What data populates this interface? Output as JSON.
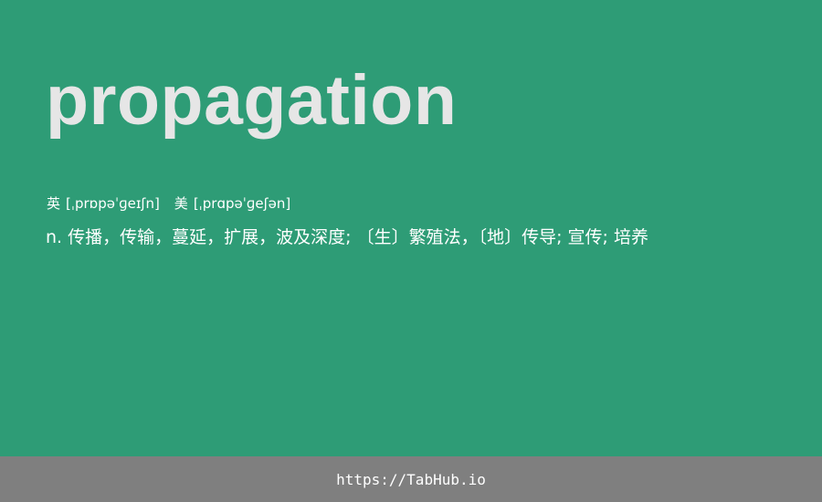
{
  "entry": {
    "word": "propagation",
    "phonetics": {
      "uk_label": "英",
      "uk_ipa": "[ˌprɒpəˈɡeɪʃn]",
      "us_label": "美",
      "us_ipa": "[ˌprɑpəˈɡeʃən]"
    },
    "definition": "n. 传播，传输，蔓延，扩展，波及深度; 〔生〕繁殖法，〔地〕传导; 宣传; 培养"
  },
  "footer": {
    "link_text": "https://TabHub.io"
  },
  "colors": {
    "background": "#2e9c76",
    "word_text": "#e6e6e6",
    "body_text": "#ffffff",
    "footer_background": "#7f7f7f"
  }
}
